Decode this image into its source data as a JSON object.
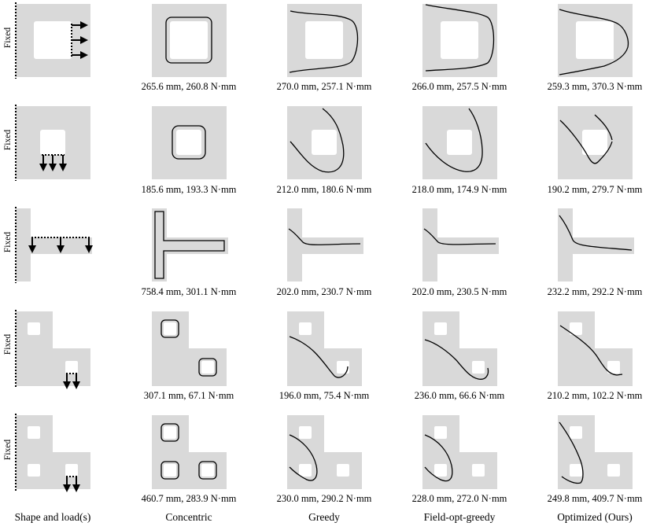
{
  "columns": [
    "Shape and load(s)",
    "Concentric",
    "Greedy",
    "Field-opt-greedy",
    "Optimized (Ours)"
  ],
  "fixed_label": "Fixed",
  "rows": [
    {
      "captions": [
        "265.6 mm, 260.8 N·mm",
        "270.0 mm, 257.1 N·mm",
        "266.0 mm, 257.5 N·mm",
        "259.3 mm, 370.3 N·mm"
      ]
    },
    {
      "captions": [
        "185.6 mm, 193.3 N·mm",
        "212.0 mm, 180.6 N·mm",
        "218.0 mm, 174.9 N·mm",
        "190.2 mm, 279.7 N·mm"
      ]
    },
    {
      "captions": [
        "758.4 mm, 301.1 N·mm",
        "202.0 mm, 230.7 N·mm",
        "202.0 mm, 230.5 N·mm",
        "232.2 mm, 292.2 N·mm"
      ]
    },
    {
      "captions": [
        "307.1 mm, 67.1 N·mm",
        "196.0 mm, 75.4 N·mm",
        "236.0 mm, 66.6 N·mm",
        "210.2 mm, 102.2 N·mm"
      ]
    },
    {
      "captions": [
        "460.7 mm, 283.9 N·mm",
        "230.0 mm, 290.2 N·mm",
        "228.0 mm, 272.0 N·mm",
        "249.8 mm, 409.7 N·mm"
      ]
    }
  ],
  "colors": {
    "material": "#d9d9d9",
    "hole": "#ffffff",
    "path": "#000000"
  }
}
